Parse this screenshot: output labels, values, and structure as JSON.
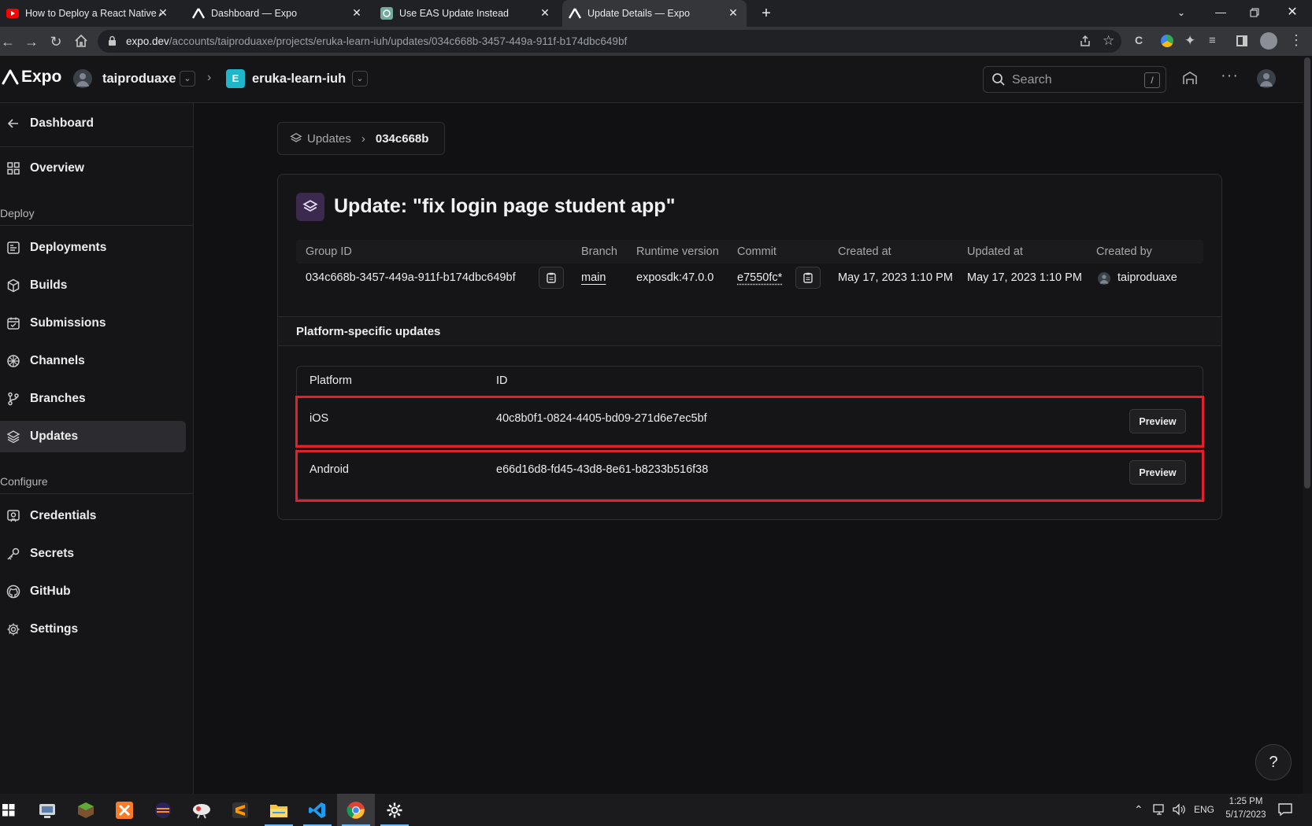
{
  "browser": {
    "tabs": [
      {
        "title": "How to Deploy a React Native Ap",
        "favicon": "youtube-icon"
      },
      {
        "title": "Dashboard — Expo",
        "favicon": "expo-icon"
      },
      {
        "title": "Use EAS Update Instead",
        "favicon": "chatgpt-icon"
      },
      {
        "title": "Update Details — Expo",
        "favicon": "expo-icon",
        "active": true
      }
    ],
    "url_host": "expo.dev",
    "url_path": "/accounts/taiproduaxe/projects/eruka-learn-iuh/updates/034c668b-3457-449a-911f-b174dbc649bf"
  },
  "header": {
    "logo": "Expo",
    "account": "taiproduaxe",
    "project_initial": "E",
    "project": "eruka-learn-iuh",
    "search_placeholder": "Search",
    "search_shortcut": "/"
  },
  "sidebar": {
    "back_label": "Dashboard",
    "overview": "Overview",
    "deploy_section": "Deploy",
    "deploy_items": [
      "Deployments",
      "Builds",
      "Submissions",
      "Channels",
      "Branches",
      "Updates"
    ],
    "configure_section": "Configure",
    "configure_items": [
      "Credentials",
      "Secrets",
      "GitHub",
      "Settings"
    ]
  },
  "breadcrumb": {
    "parent": "Updates",
    "current": "034c668b"
  },
  "update": {
    "title": "Update: \"fix login page student app\"",
    "headers": {
      "group_id": "Group ID",
      "branch": "Branch",
      "runtime": "Runtime version",
      "commit": "Commit",
      "created_at": "Created at",
      "updated_at": "Updated at",
      "created_by": "Created by"
    },
    "values": {
      "group_id": "034c668b-3457-449a-911f-b174dbc649bf",
      "branch": "main",
      "runtime": "exposdk:47.0.0",
      "commit": "e7550fc*",
      "created_at": "May 17, 2023 1:10 PM",
      "updated_at": "May 17, 2023 1:10 PM",
      "created_by": "taiproduaxe"
    }
  },
  "platform_updates": {
    "section_title": "Platform-specific updates",
    "col_platform": "Platform",
    "col_id": "ID",
    "rows": [
      {
        "platform": "iOS",
        "id": "40c8b0f1-0824-4405-bd09-271d6e7ec5bf",
        "action": "Preview"
      },
      {
        "platform": "Android",
        "id": "e66d16d8-fd45-43d8-8e61-b8233b516f38",
        "action": "Preview"
      }
    ]
  },
  "help_label": "?",
  "taskbar": {
    "tray_lang": "ENG",
    "time": "1:25 PM",
    "date": "5/17/2023"
  },
  "colors": {
    "highlight": "#e0202a",
    "project_badge": "#1fb6c9",
    "update_icon_bg": "#3b2a4d"
  }
}
